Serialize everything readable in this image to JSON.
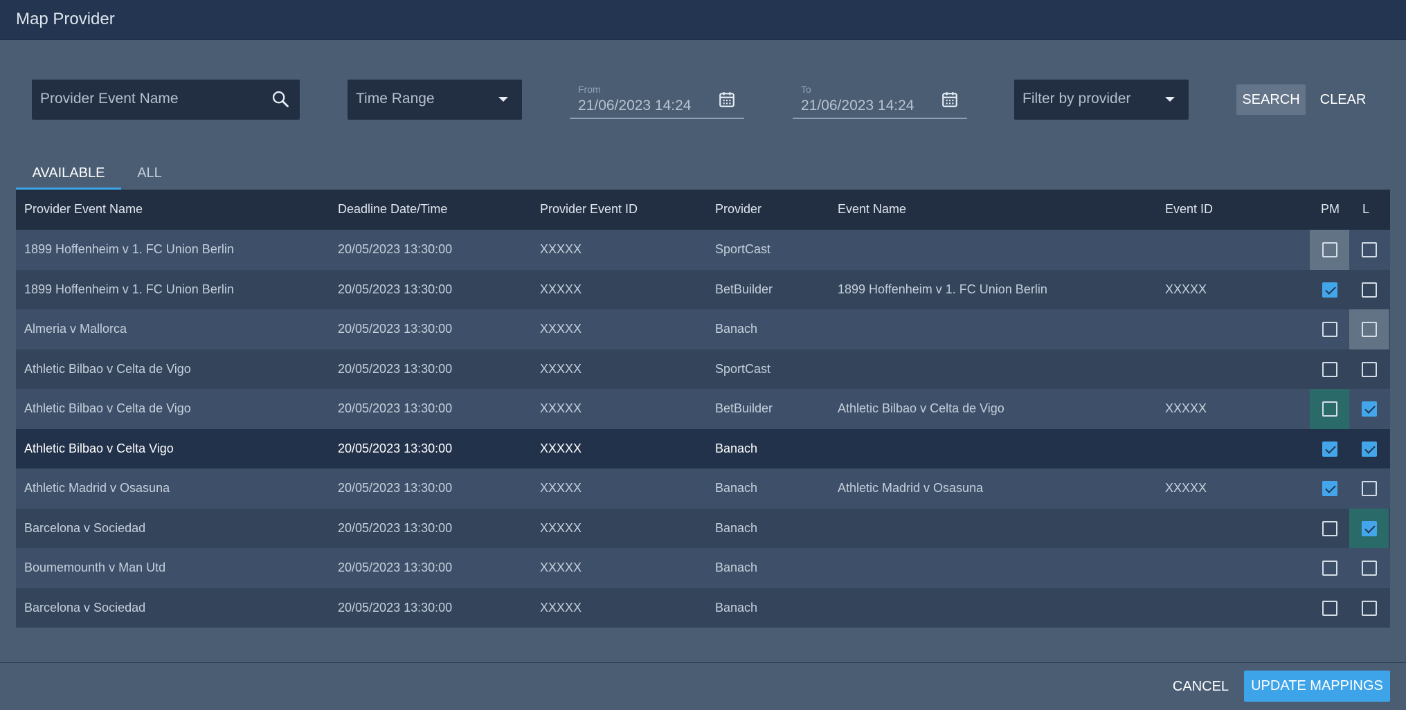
{
  "dialog": {
    "title": "Map Provider"
  },
  "filters": {
    "search_placeholder": "Provider Event Name",
    "time_range_label": "Time Range",
    "from_label": "From",
    "from_value": "21/06/2023 14:24",
    "to_label": "To",
    "to_value": "21/06/2023 14:24",
    "provider_label": "Filter by provider",
    "search_button": "SEARCH",
    "clear_button": "CLEAR"
  },
  "tabs": [
    {
      "label": "AVAILABLE",
      "active": true
    },
    {
      "label": "ALL",
      "active": false
    }
  ],
  "table": {
    "columns": [
      "Provider Event Name",
      "Deadline Date/Time",
      "Provider Event ID",
      "Provider",
      "Event Name",
      "Event ID",
      "PM",
      "L"
    ],
    "rows": [
      {
        "provider_event_name": "1899 Hoffenheim v 1. FC Union Berlin",
        "deadline": "20/05/2023  13:30:00",
        "provider_event_id": "XXXXX",
        "provider": "SportCast",
        "event_name": "",
        "event_id": "",
        "pm": false,
        "l": false,
        "pm_highlight": "gray",
        "l_highlight": ""
      },
      {
        "provider_event_name": "1899 Hoffenheim v 1. FC Union Berlin",
        "deadline": "20/05/2023  13:30:00",
        "provider_event_id": "XXXXX",
        "provider": "BetBuilder",
        "event_name": "1899 Hoffenheim v 1. FC Union Berlin",
        "event_id": "XXXXX",
        "pm": true,
        "l": false,
        "pm_highlight": "",
        "l_highlight": ""
      },
      {
        "provider_event_name": "Almeria v Mallorca",
        "deadline": "20/05/2023  13:30:00",
        "provider_event_id": "XXXXX",
        "provider": "Banach",
        "event_name": "",
        "event_id": "",
        "pm": false,
        "l": false,
        "pm_highlight": "",
        "l_highlight": "gray"
      },
      {
        "provider_event_name": "Athletic Bilbao v Celta de  Vigo",
        "deadline": "20/05/2023  13:30:00",
        "provider_event_id": "XXXXX",
        "provider": "SportCast",
        "event_name": "",
        "event_id": "",
        "pm": false,
        "l": false,
        "pm_highlight": "",
        "l_highlight": ""
      },
      {
        "provider_event_name": "Athletic Bilbao v Celta de  Vigo",
        "deadline": "20/05/2023  13:30:00",
        "provider_event_id": "XXXXX",
        "provider": "BetBuilder",
        "event_name": "Athletic Bilbao v Celta de  Vigo",
        "event_id": "XXXXX",
        "pm": false,
        "l": true,
        "pm_highlight": "teal",
        "l_highlight": ""
      },
      {
        "provider_event_name": "Athletic Bilbao v Celta Vigo",
        "deadline": "20/05/2023  13:30:00",
        "provider_event_id": "XXXXX",
        "provider": "Banach",
        "event_name": "",
        "event_id": "",
        "pm": true,
        "l": true,
        "pm_highlight": "",
        "l_highlight": "",
        "selected": true
      },
      {
        "provider_event_name": "Athletic Madrid v Osasuna",
        "deadline": "20/05/2023  13:30:00",
        "provider_event_id": "XXXXX",
        "provider": "Banach",
        "event_name": "Athletic Madrid v Osasuna",
        "event_id": "XXXXX",
        "pm": true,
        "l": false,
        "pm_highlight": "",
        "l_highlight": ""
      },
      {
        "provider_event_name": "Barcelona v Sociedad",
        "deadline": "20/05/2023  13:30:00",
        "provider_event_id": "XXXXX",
        "provider": "Banach",
        "event_name": "",
        "event_id": "",
        "pm": false,
        "l": true,
        "pm_highlight": "",
        "l_highlight": "teal"
      },
      {
        "provider_event_name": "Boumemounth v Man Utd",
        "deadline": "20/05/2023  13:30:00",
        "provider_event_id": "XXXXX",
        "provider": "Banach",
        "event_name": "",
        "event_id": "",
        "pm": false,
        "l": false,
        "pm_highlight": "",
        "l_highlight": ""
      },
      {
        "provider_event_name": "Barcelona v Sociedad",
        "deadline": "20/05/2023  13:30:00",
        "provider_event_id": "XXXXX",
        "provider": "Banach",
        "event_name": "",
        "event_id": "",
        "pm": false,
        "l": false,
        "pm_highlight": "",
        "l_highlight": ""
      }
    ]
  },
  "footer": {
    "cancel_button": "CANCEL",
    "update_button": "UPDATE MAPPINGS"
  },
  "colors": {
    "accent": "#3ea4e9",
    "background": "#4b5d73",
    "header": "#233550",
    "highlight_teal": "#2a6b6a",
    "highlight_gray": "#637386"
  }
}
